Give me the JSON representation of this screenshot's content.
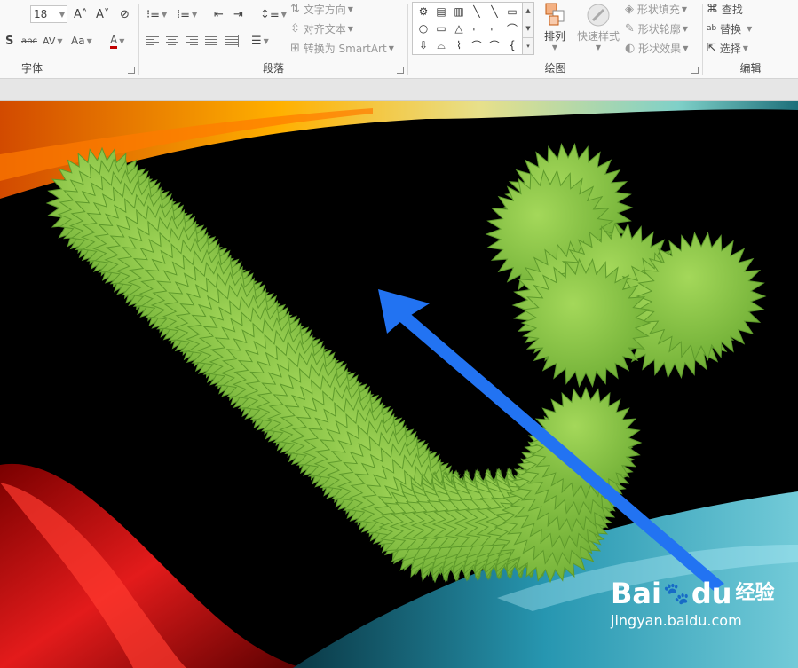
{
  "ribbon": {
    "font": {
      "size_value": "18",
      "grow_font_icon": "A˄",
      "shrink_font_icon": "A˅",
      "clear_format_icon": "⊘",
      "shadow_label": "S",
      "strike_label": "abc",
      "spacing_label": "AV",
      "case_label": "Aa",
      "color_label": "A",
      "group_label": "字体"
    },
    "paragraph": {
      "text_direction": "文字方向",
      "align_text": "对齐文本",
      "convert_smartart": "转换为 SmartArt",
      "group_label": "段落"
    },
    "drawing": {
      "arrange_label": "排列",
      "quick_styles_label": "快速样式",
      "shape_fill_label": "形状填充",
      "shape_outline_label": "形状轮廓",
      "shape_effects_label": "形状效果",
      "group_label": "绘图"
    },
    "editing": {
      "find_label": "查找",
      "replace_label": "替换",
      "select_label": "选择",
      "group_label": "编辑"
    }
  },
  "shapes_gallery": [
    "⚙",
    "▤",
    "▥",
    "╲",
    "╲",
    "▭",
    "○",
    "▭",
    "△",
    "⌐",
    "⌐",
    "⌒",
    "⇩",
    "⌓",
    "⌇",
    "⌒",
    "⌒",
    "{"
  ],
  "watermark": {
    "brand": "Bai",
    "brand_du": "du",
    "brand_cn": "经验",
    "url": "jingyan.baidu.com"
  },
  "colors": {
    "spike_green": "#8fc94a",
    "arrow_blue": "#2273f2",
    "ribbon_bg": "#f9f9f9"
  }
}
